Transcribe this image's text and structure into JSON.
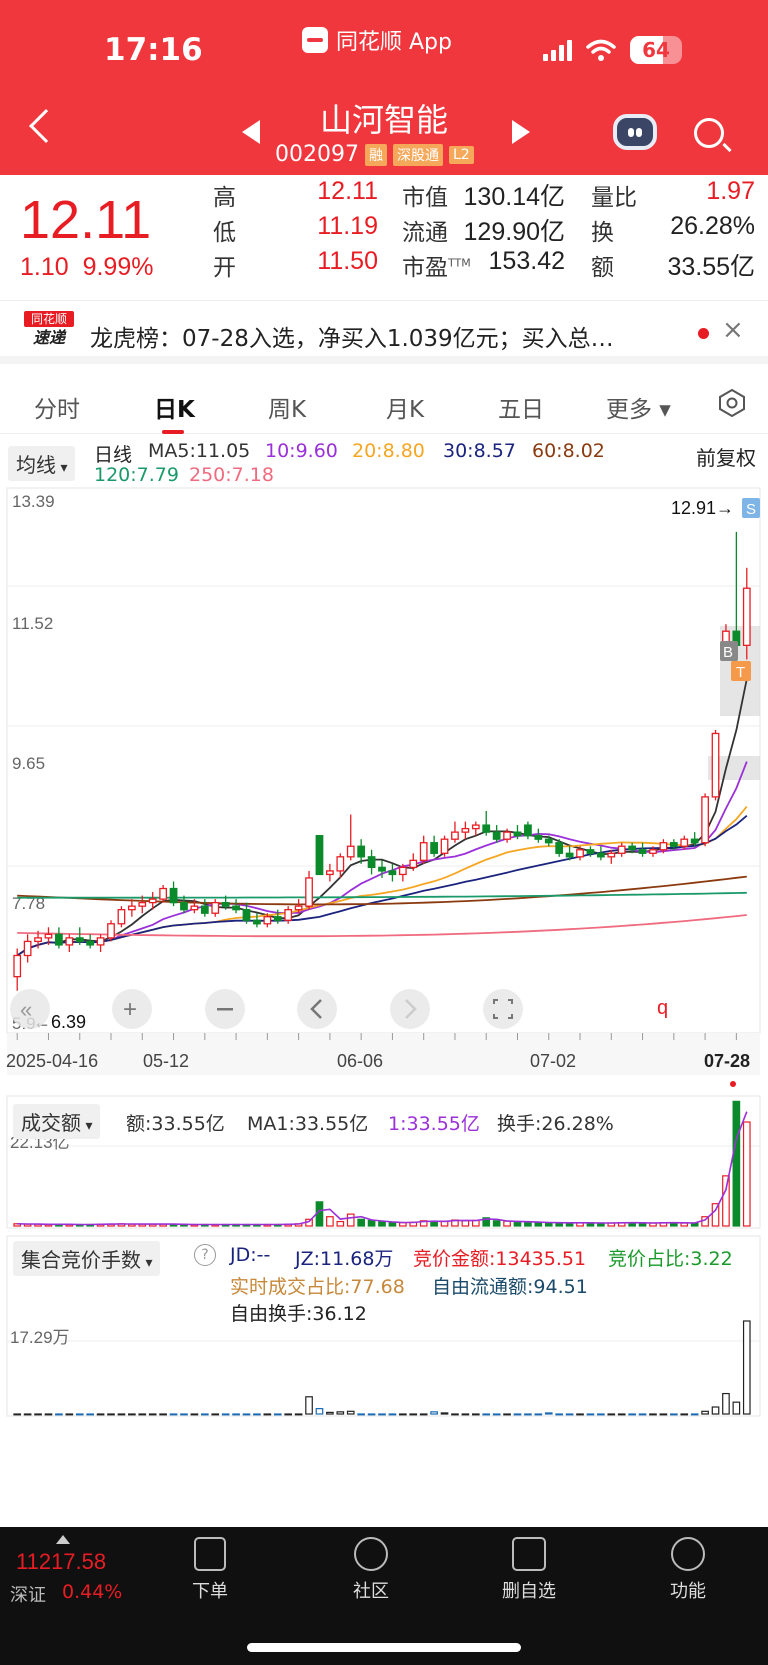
{
  "status_bar": {
    "time": "17:16",
    "app_name": "同花顺 App",
    "battery": "64",
    "battery_level": 0.64
  },
  "header": {
    "stock_name": "山河智能",
    "stock_code": "002097",
    "tags": [
      "融",
      "深股通",
      "L2"
    ]
  },
  "quote": {
    "price": "12.11",
    "change": "1.10",
    "change_pct": "9.99%",
    "stats": {
      "high_label": "高",
      "high": "12.11",
      "low_label": "低",
      "low": "11.19",
      "open_label": "开",
      "open": "11.50",
      "mcap_label": "市值",
      "mcap": "130.14亿",
      "float_label": "流通",
      "float": "129.90亿",
      "pe_label": "市盈",
      "pe_sup": "TTM",
      "pe": "153.42",
      "vol_ratio_label": "量比",
      "vol_ratio": "1.97",
      "turnover_label": "换",
      "turnover": "26.28%",
      "amount_label": "额",
      "amount": "33.55亿"
    }
  },
  "news": {
    "logo_top": "同花顺",
    "logo_bottom": "速递",
    "text": "龙虎榜：07-28入选，净买入1.039亿元；买入总…"
  },
  "tabs": [
    "分时",
    "日K",
    "周K",
    "月K",
    "五日",
    "更多"
  ],
  "active_tab": 1,
  "chart": {
    "indicator_btn": "均线",
    "period_label": "日线",
    "ma": [
      {
        "label": "MA5:11.05",
        "color": "#333333"
      },
      {
        "label": "10:9.60",
        "color": "#9b30d9"
      },
      {
        "label": "20:8.80",
        "color": "#f5a623"
      },
      {
        "label": "30:8.57",
        "color": "#1a237e"
      },
      {
        "label": "60:8.02",
        "color": "#8b3a0f"
      },
      {
        "label": "120:7.79",
        "color": "#1a9a6a"
      },
      {
        "label": "250:7.18",
        "color": "#f06b7f"
      }
    ],
    "adjust_label": "前复权",
    "high_marker": "12.91→",
    "low_marker": "←6.39",
    "y_ticks": [
      "13.39",
      "11.52",
      "9.65",
      "7.78",
      "5.9"
    ],
    "x_labels": [
      "2025-04-16",
      "05-12",
      "06-06",
      "07-02",
      "07-28"
    ],
    "marker_s": "S",
    "marker_b": "B",
    "marker_t": "T",
    "marker_q": "q"
  },
  "volume_panel": {
    "indicator_btn": "成交额",
    "amount": "额:33.55亿",
    "ma1": "MA1:33.55亿",
    "ma1_alt": "1:33.55亿",
    "turnover": "换手:26.28%",
    "y_tick": "22.13亿"
  },
  "auction_panel": {
    "indicator_btn": "集合竞价手数",
    "help_icon": "?",
    "jd": "JD:--",
    "jz": "JZ:11.68万",
    "bid_amount": "竞价金额:13435.51",
    "bid_ratio": "竞价占比:3.22",
    "realtime_ratio": "实时成交占比:77.68",
    "free_float": "自由流通额:94.51",
    "free_turnover": "自由换手:36.12",
    "y_tick": "17.29万"
  },
  "bottom_bar": {
    "index_value": "11217.58",
    "index_name": "深证",
    "index_pct": "0.44%",
    "nav": [
      "下单",
      "社区",
      "删自选",
      "功能"
    ]
  },
  "chart_data": {
    "type": "candlestick",
    "title": "山河智能 日K",
    "x_range": [
      "2025-04-16",
      "2025-07-28"
    ],
    "ylim": [
      5.9,
      13.39
    ],
    "x_labels": [
      "2025-04-16",
      "05-12",
      "06-06",
      "07-02",
      "07-28"
    ],
    "candles": [
      [
        6.6,
        7.0,
        6.4,
        6.9
      ],
      [
        6.9,
        7.2,
        6.8,
        7.1
      ],
      [
        7.1,
        7.25,
        7.0,
        7.15
      ],
      [
        7.15,
        7.3,
        7.05,
        7.2
      ],
      [
        7.2,
        7.3,
        7.0,
        7.05
      ],
      [
        7.05,
        7.2,
        6.95,
        7.15
      ],
      [
        7.15,
        7.3,
        7.05,
        7.1
      ],
      [
        7.1,
        7.2,
        7.0,
        7.05
      ],
      [
        7.05,
        7.2,
        6.95,
        7.15
      ],
      [
        7.15,
        7.4,
        7.1,
        7.35
      ],
      [
        7.35,
        7.6,
        7.3,
        7.55
      ],
      [
        7.55,
        7.7,
        7.45,
        7.6
      ],
      [
        7.6,
        7.75,
        7.5,
        7.65
      ],
      [
        7.65,
        7.8,
        7.55,
        7.7
      ],
      [
        7.7,
        7.9,
        7.65,
        7.85
      ],
      [
        7.85,
        7.95,
        7.6,
        7.65
      ],
      [
        7.65,
        7.75,
        7.5,
        7.55
      ],
      [
        7.55,
        7.7,
        7.5,
        7.6
      ],
      [
        7.6,
        7.7,
        7.45,
        7.5
      ],
      [
        7.5,
        7.7,
        7.45,
        7.65
      ],
      [
        7.65,
        7.75,
        7.55,
        7.6
      ],
      [
        7.6,
        7.7,
        7.5,
        7.55
      ],
      [
        7.55,
        7.65,
        7.35,
        7.4
      ],
      [
        7.4,
        7.5,
        7.3,
        7.35
      ],
      [
        7.35,
        7.5,
        7.3,
        7.45
      ],
      [
        7.45,
        7.55,
        7.35,
        7.4
      ],
      [
        7.4,
        7.6,
        7.35,
        7.55
      ],
      [
        7.55,
        7.7,
        7.5,
        7.6
      ],
      [
        7.6,
        8.1,
        7.55,
        8.0
      ],
      [
        8.6,
        8.6,
        8.05,
        8.05
      ],
      [
        8.05,
        8.2,
        7.95,
        8.1
      ],
      [
        8.1,
        8.35,
        8.0,
        8.3
      ],
      [
        8.3,
        8.9,
        8.25,
        8.45
      ],
      [
        8.45,
        8.55,
        8.2,
        8.3
      ],
      [
        8.3,
        8.4,
        8.05,
        8.15
      ],
      [
        8.15,
        8.25,
        8.0,
        8.1
      ],
      [
        8.1,
        8.2,
        7.95,
        8.05
      ],
      [
        8.05,
        8.2,
        7.95,
        8.15
      ],
      [
        8.15,
        8.35,
        8.1,
        8.25
      ],
      [
        8.25,
        8.6,
        8.2,
        8.5
      ],
      [
        8.5,
        8.6,
        8.3,
        8.35
      ],
      [
        8.35,
        8.6,
        8.3,
        8.55
      ],
      [
        8.55,
        8.8,
        8.5,
        8.65
      ],
      [
        8.65,
        8.8,
        8.55,
        8.7
      ],
      [
        8.7,
        8.8,
        8.6,
        8.75
      ],
      [
        8.75,
        8.95,
        8.6,
        8.65
      ],
      [
        8.65,
        8.75,
        8.5,
        8.55
      ],
      [
        8.55,
        8.7,
        8.5,
        8.65
      ],
      [
        8.65,
        8.75,
        8.55,
        8.6
      ],
      [
        8.75,
        8.8,
        8.55,
        8.6
      ],
      [
        8.6,
        8.7,
        8.5,
        8.55
      ],
      [
        8.55,
        8.6,
        8.45,
        8.5
      ],
      [
        8.5,
        8.55,
        8.3,
        8.35
      ],
      [
        8.35,
        8.45,
        8.25,
        8.3
      ],
      [
        8.3,
        8.45,
        8.25,
        8.4
      ],
      [
        8.4,
        8.45,
        8.3,
        8.35
      ],
      [
        8.35,
        8.45,
        8.25,
        8.3
      ],
      [
        8.3,
        8.4,
        8.2,
        8.35
      ],
      [
        8.35,
        8.5,
        8.3,
        8.45
      ],
      [
        8.45,
        8.5,
        8.35,
        8.4
      ],
      [
        8.4,
        8.5,
        8.3,
        8.35
      ],
      [
        8.35,
        8.45,
        8.3,
        8.4
      ],
      [
        8.4,
        8.55,
        8.35,
        8.5
      ],
      [
        8.5,
        8.55,
        8.4,
        8.45
      ],
      [
        8.45,
        8.6,
        8.4,
        8.55
      ],
      [
        8.55,
        8.65,
        8.45,
        8.5
      ],
      [
        8.5,
        9.2,
        8.45,
        9.15
      ],
      [
        9.15,
        10.1,
        9.1,
        10.05
      ],
      [
        11.3,
        11.6,
        11.2,
        11.5
      ],
      [
        11.5,
        12.91,
        11.0,
        11.3
      ],
      [
        11.3,
        12.4,
        11.1,
        12.11
      ]
    ],
    "volume": [
      0.6,
      0.5,
      0.5,
      0.4,
      0.5,
      0.4,
      0.4,
      0.4,
      0.5,
      0.5,
      0.6,
      0.5,
      0.5,
      0.5,
      0.5,
      0.5,
      0.4,
      0.4,
      0.4,
      0.4,
      0.4,
      0.4,
      0.4,
      0.4,
      0.4,
      0.4,
      0.5,
      0.6,
      1.8,
      6.5,
      2.5,
      1.2,
      3.2,
      1.8,
      1.5,
      1.2,
      1.0,
      0.9,
      1.0,
      1.4,
      1.2,
      1.3,
      1.6,
      1.4,
      1.5,
      2.2,
      1.4,
      1.3,
      1.2,
      1.1,
      1.0,
      0.9,
      0.9,
      0.8,
      0.9,
      0.8,
      0.8,
      0.8,
      0.9,
      0.9,
      0.8,
      0.8,
      0.9,
      0.9,
      0.8,
      0.8,
      2.5,
      6.0,
      13.5,
      33.55,
      28.0
    ],
    "auction": [
      0,
      0,
      0,
      0,
      0,
      0,
      0,
      0,
      0,
      0,
      0,
      0,
      0,
      0,
      0,
      0,
      0,
      0,
      0,
      0,
      0,
      0,
      0,
      0,
      0,
      0,
      0,
      0,
      3.2,
      1.0,
      0.3,
      0.4,
      0.5,
      0,
      0,
      0,
      0,
      0,
      0,
      0,
      0.4,
      0.2,
      0,
      0,
      0,
      0,
      0,
      0,
      0,
      0,
      0,
      0.2,
      0,
      0,
      0,
      0,
      0,
      0,
      0,
      0,
      0,
      0,
      0,
      0,
      0,
      0,
      0.5,
      1.3,
      3.8,
      2.2,
      17.29,
      11.0,
      6.0
    ]
  }
}
